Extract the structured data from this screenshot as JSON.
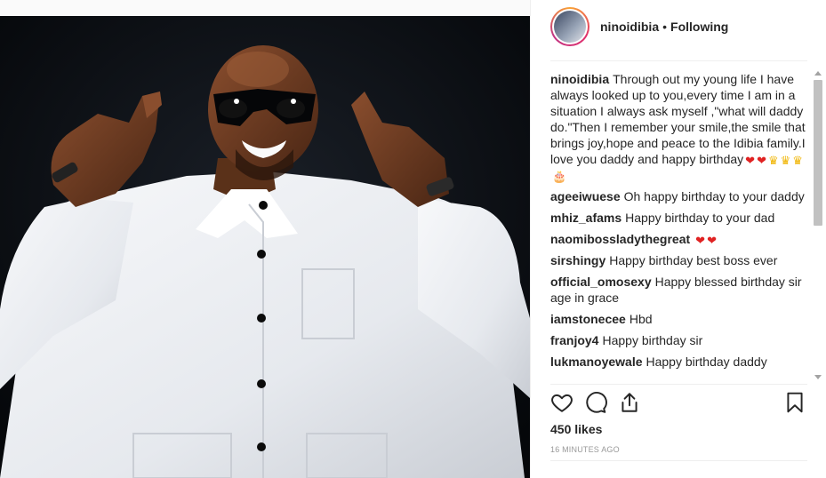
{
  "post": {
    "username": "ninoidibia",
    "separator": "•",
    "follow_status": "Following"
  },
  "comments": [
    {
      "user": "ninoidibia",
      "text": "Through out my young life I have always looked up to you,every time I am in a situation I always ask myself ,\"what will daddy do.\"Then I remember your smile,the smile that brings joy,hope and peace to the Idibia family.I love you daddy and happy birthday",
      "emoji": [
        "❤",
        "❤",
        "♛",
        "♛",
        "♛",
        "🎂"
      ]
    },
    {
      "user": "ageeiwuese",
      "text": "Oh happy birthday to your daddy"
    },
    {
      "user": "mhiz_afams",
      "text": "Happy birthday to your dad"
    },
    {
      "user": "naomibossladythegreat",
      "text": "",
      "emoji": [
        "❤",
        "❤"
      ]
    },
    {
      "user": "sirshingy",
      "text": "Happy birthday best boss ever"
    },
    {
      "user": "official_omosexy",
      "text": "Happy blessed birthday sir age in grace"
    },
    {
      "user": "iamstonecee",
      "text": "Hbd"
    },
    {
      "user": "franjoy4",
      "text": "Happy birthday sir"
    },
    {
      "user": "lukmanoyewale",
      "text": "Happy birthday daddy"
    }
  ],
  "icons": {
    "like": "heart-icon",
    "comment": "comment-icon",
    "share": "share-icon",
    "save": "bookmark-icon"
  },
  "likes": "450 likes",
  "timestamp": "16 MINUTES AGO"
}
